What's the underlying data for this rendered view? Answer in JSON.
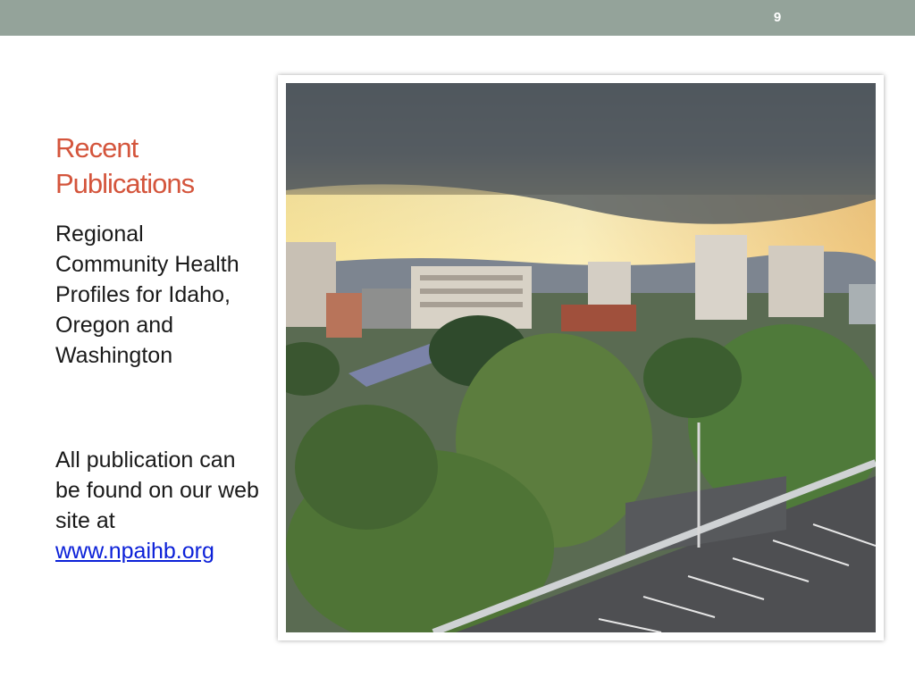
{
  "slide": {
    "number": "9",
    "title": "Recent Publications",
    "paragraph1": "Regional Community Health Profiles for Idaho, Oregon and Washington",
    "paragraph2_prefix": "All publication can be found on our web site at ",
    "link_text": "www.npaihb.org"
  },
  "colors": {
    "header_bar": "#94a39a",
    "title": "#d4553c",
    "link": "#0b20d8"
  }
}
